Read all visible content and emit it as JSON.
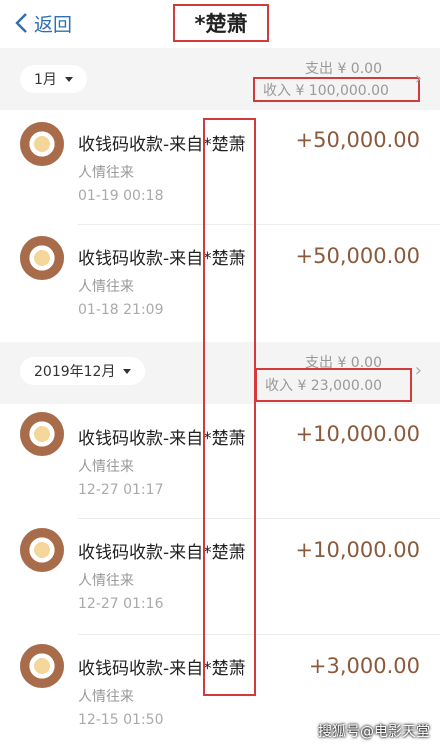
{
  "header": {
    "back_label": "返回",
    "title": "*楚萧"
  },
  "sections": [
    {
      "month": "1月",
      "out_text": "支出 ¥ 0.00",
      "in_text": "收入 ¥ 100,000.00"
    },
    {
      "month": "2019年12月",
      "out_text": "支出 ¥ 0.00",
      "in_text": "收入 ¥ 23,000.00"
    }
  ],
  "transactions": [
    {
      "title": "收钱码收款-来自*楚萧",
      "category": "人情往来",
      "date": "01-19  00:18",
      "amount": "+50,000.00"
    },
    {
      "title": "收钱码收款-来自*楚萧",
      "category": "人情往来",
      "date": "01-18  21:09",
      "amount": "+50,000.00"
    },
    {
      "title": "收钱码收款-来自*楚萧",
      "category": "人情往来",
      "date": "12-27  01:17",
      "amount": "+10,000.00"
    },
    {
      "title": "收钱码收款-来自*楚萧",
      "category": "人情往来",
      "date": "12-27  01:16",
      "amount": "+10,000.00"
    },
    {
      "title": "收钱码收款-来自*楚萧",
      "category": "人情往来",
      "date": "12-15  01:50",
      "amount": "+3,000.00"
    }
  ],
  "watermark": "搜狐号@电影天堂",
  "colors": {
    "accent": "#2f6fb3",
    "amount": "#8b5a3c",
    "highlight": "#d23b3b"
  },
  "icons": {
    "back": "chevron-left-icon",
    "avatar": "avatar",
    "month_caret": "caret-down-icon",
    "detail": "chevron-right-icon"
  }
}
